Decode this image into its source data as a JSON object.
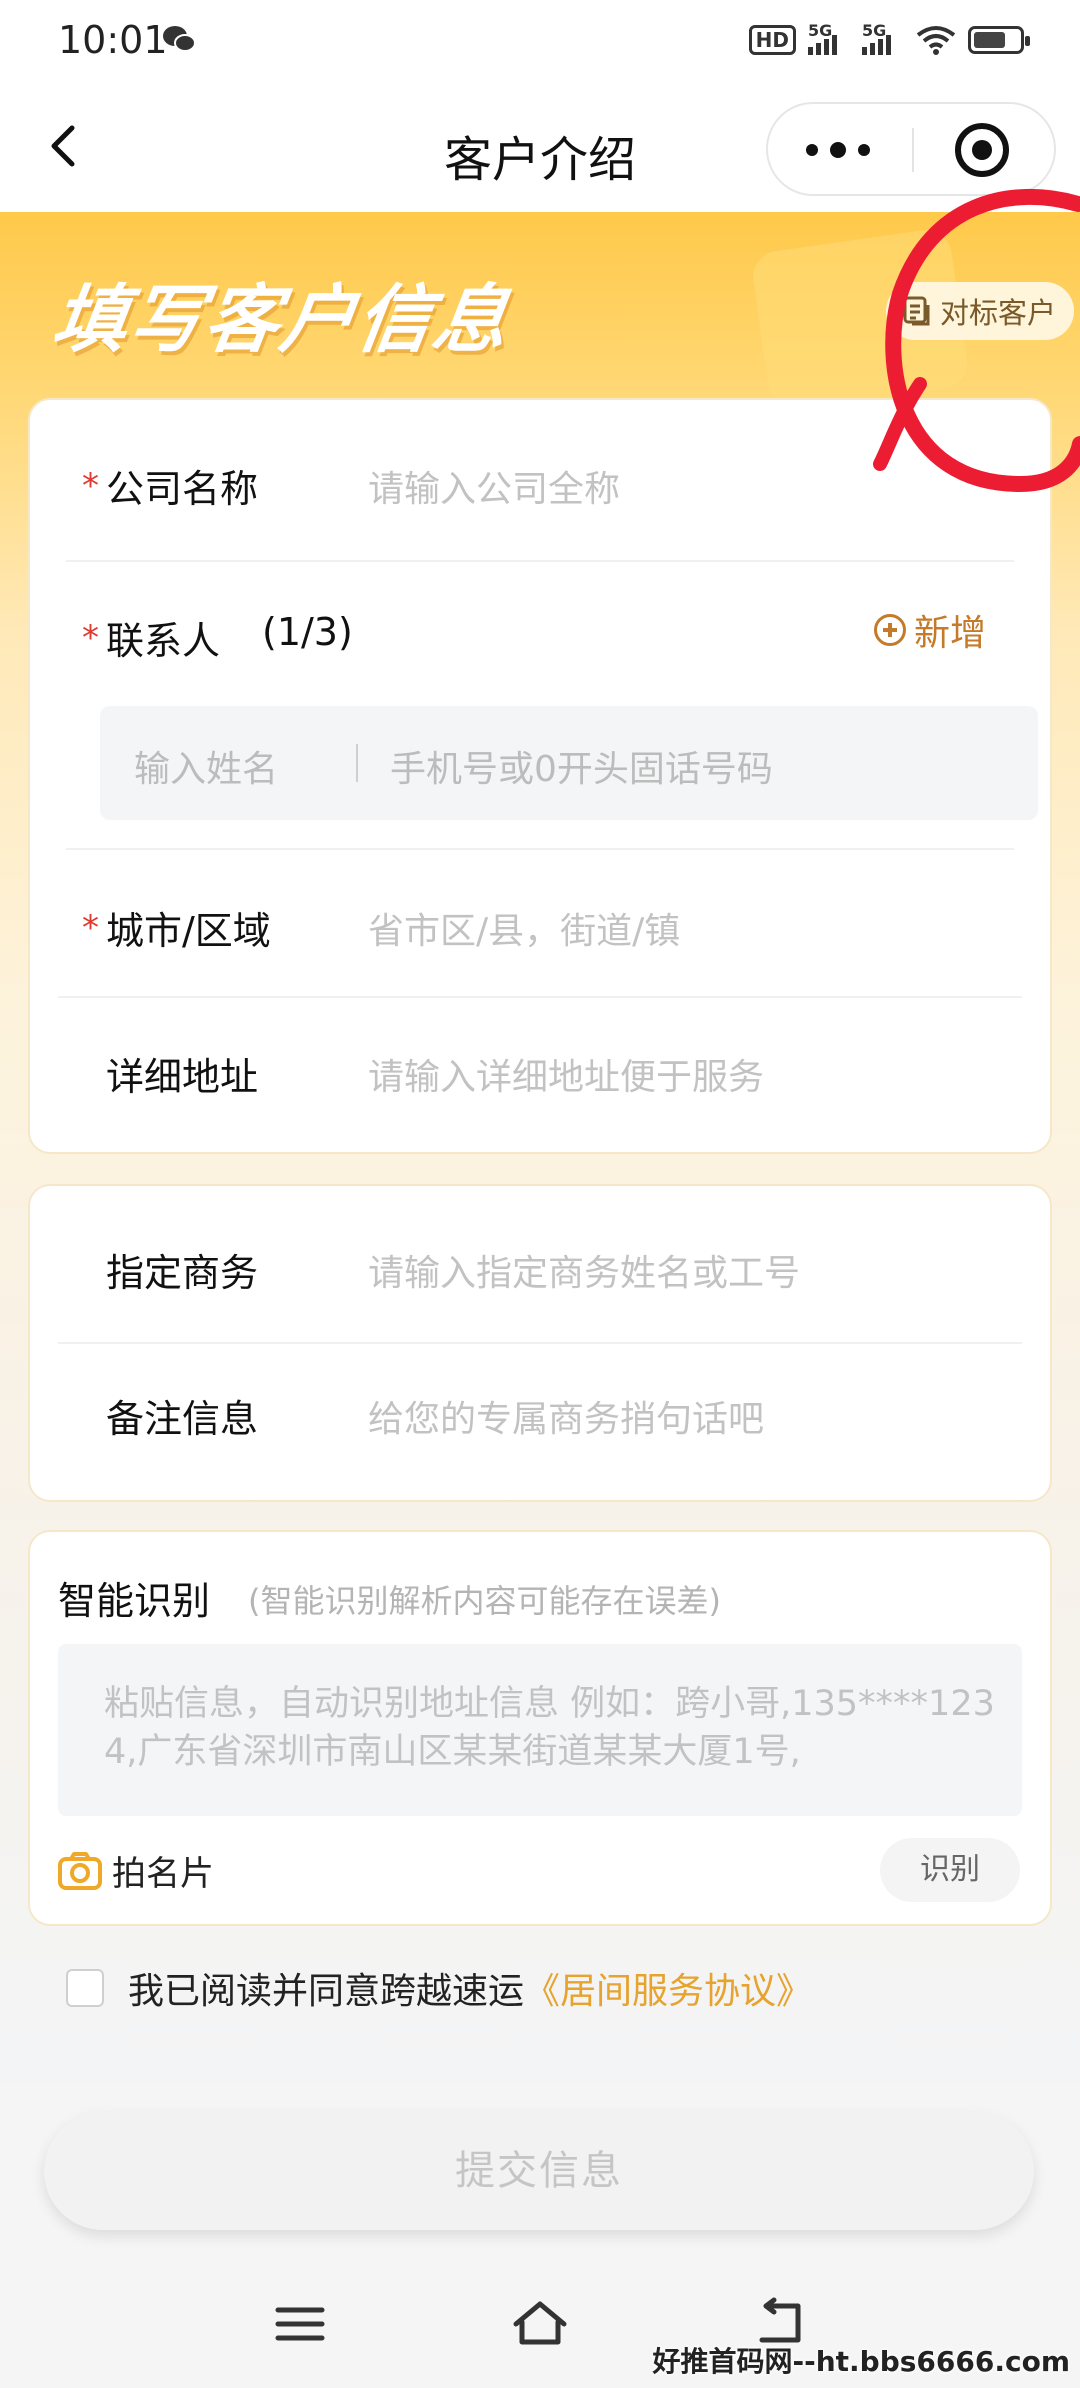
{
  "status_bar": {
    "time": "10:01",
    "hd_label": "HD",
    "network_1": "5G",
    "network_2": "5G",
    "battery_level": 0.7
  },
  "nav": {
    "title": "客户介绍"
  },
  "banner": {
    "title": "填写客户信息",
    "benchmark_label": "对标客户"
  },
  "form": {
    "company": {
      "required": "*",
      "label": "公司名称",
      "placeholder": "请输入公司全称"
    },
    "contact": {
      "required": "*",
      "label": "联系人",
      "count": "(1/3)",
      "add_label": "新增",
      "name_placeholder": "输入姓名",
      "phone_placeholder": "手机号或0开头固话号码"
    },
    "city": {
      "required": "*",
      "label": "城市/区域",
      "placeholder": "省市区/县，街道/镇"
    },
    "address": {
      "label": "详细地址",
      "placeholder": "请输入详细地址便于服务"
    },
    "business": {
      "label": "指定商务",
      "placeholder": "请输入指定商务姓名或工号"
    },
    "remark": {
      "label": "备注信息",
      "placeholder": "给您的专属商务捎句话吧"
    }
  },
  "smart": {
    "title": "智能识别",
    "hint": "(智能识别解析内容可能存在误差)",
    "paste_placeholder": "粘贴信息，自动识别地址信息 例如：跨小哥,135****1234,广东省深圳市南山区某某街道某某大厦1号,",
    "photo_label": "拍名片",
    "recognize_label": "识别"
  },
  "agreement": {
    "text": "我已阅读并同意跨越速运",
    "link": "《居间服务协议》"
  },
  "submit_label": "提交信息",
  "watermark": "好推首码网--ht.bbs6666.com",
  "colors": {
    "accent": "#e6a32e",
    "required": "#e0392f",
    "banner": "#ffc94a",
    "annotation": "#ec1d33"
  }
}
